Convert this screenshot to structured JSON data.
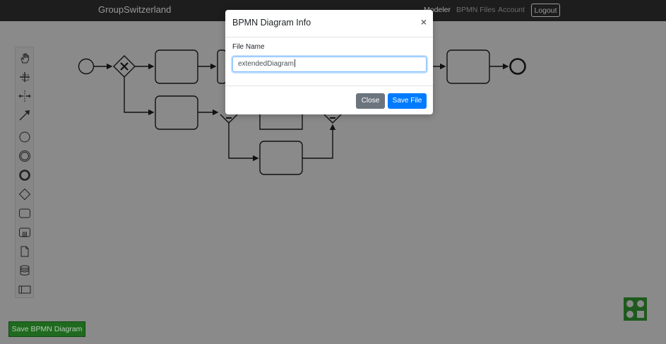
{
  "navbar": {
    "brand": "GroupSwitzerland",
    "links": [
      "Modeler",
      "BPMN Files",
      "Account"
    ],
    "logout_label": "Logout"
  },
  "palette": {
    "tools": [
      "hand-tool-icon",
      "lasso-tool-icon",
      "space-tool-icon",
      "global-connect-icon",
      "start-event-icon",
      "intermediate-event-icon",
      "end-event-icon",
      "gateway-icon",
      "task-icon",
      "subprocess-icon",
      "data-object-icon",
      "data-store-icon",
      "pool-icon"
    ]
  },
  "footer": {
    "save_diagram_label": "Save BPMN Diagram"
  },
  "modal": {
    "title": "BPMN Diagram Info",
    "close_symbol": "×",
    "file_name_label": "File Name",
    "file_name_value": "extendedDiagram",
    "close_button": "Close",
    "save_button": "Save File"
  },
  "colors": {
    "navbar_bg": "#1d1d1d",
    "overlay_bg": "#8a8a8a",
    "primary": "#007bff",
    "secondary": "#6c757d",
    "save_diagram_bg": "#1f6a1f",
    "bpmn_logo": "#1e5a1e"
  }
}
